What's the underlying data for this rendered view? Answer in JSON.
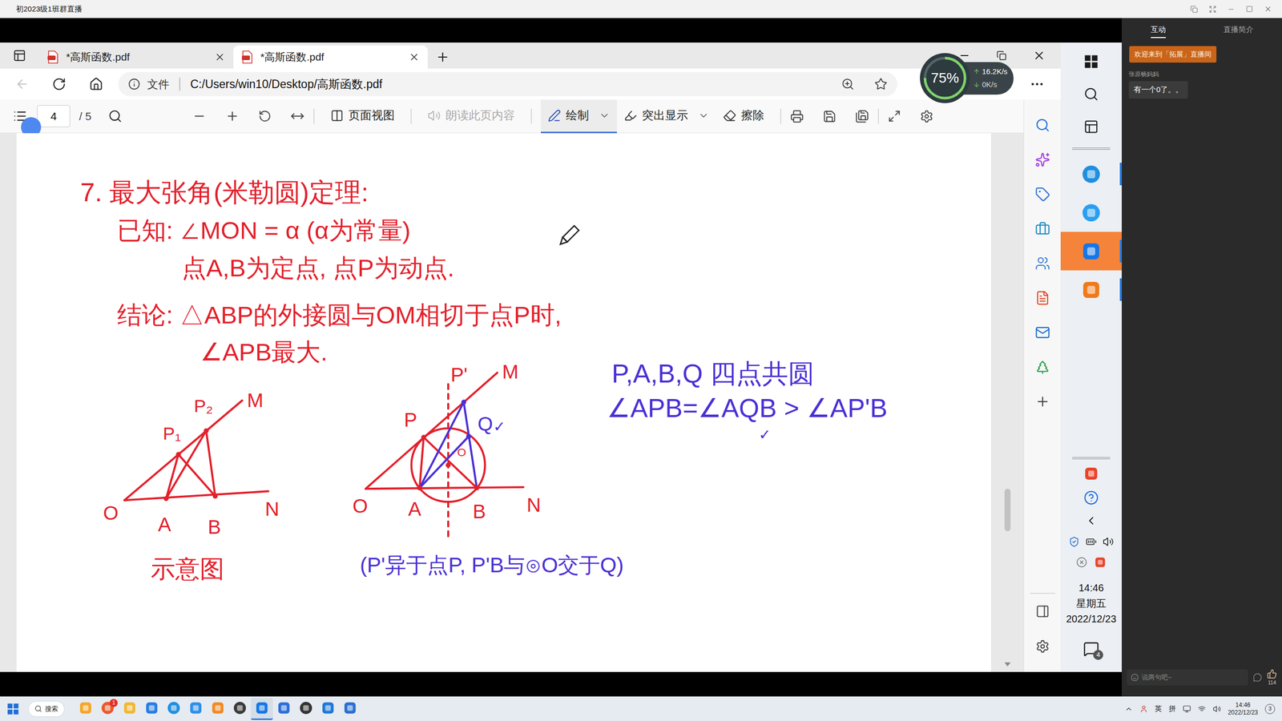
{
  "window": {
    "title": "初2023级1班群直播"
  },
  "browser": {
    "tabs": [
      {
        "label": "*高斯函数.pdf",
        "selected": false
      },
      {
        "label": "*高斯函数.pdf",
        "selected": true
      }
    ],
    "back_disabled": true,
    "address": {
      "scheme": "文件",
      "url": "C:/Users/win10/Desktop/高斯函数.pdf"
    }
  },
  "speed_widget": {
    "percent": "75%",
    "level": 0.75,
    "upload": "16.2K/s",
    "download": "0K/s"
  },
  "pdf_toolbar": {
    "page": "4",
    "total": "/ 5",
    "tools": [
      {
        "label": "页面视图",
        "selected": false,
        "disabled": false,
        "dropdown": false
      },
      {
        "label": "朗读此页内容",
        "selected": false,
        "disabled": true,
        "dropdown": false
      },
      {
        "label": "绘制",
        "selected": true,
        "disabled": false,
        "dropdown": true
      },
      {
        "label": "突出显示",
        "selected": false,
        "disabled": false,
        "dropdown": true
      },
      {
        "label": "擦除",
        "selected": false,
        "disabled": false,
        "dropdown": false
      }
    ]
  },
  "document": {
    "title": "7. 最大张角(米勒圆)定理:",
    "lines": [
      "已知: ∠MON = α (α为常量)",
      "点A,B为定点, 点P为动点.",
      "结论: △ABP的外接圆与OM相切于点P时,",
      "∠APB最大."
    ],
    "figure1": {
      "labels": [
        "O",
        "A",
        "B",
        "N",
        "M",
        "P₁",
        "P₂"
      ],
      "caption": "示意图"
    },
    "figure2": {
      "labels": [
        "O",
        "A",
        "B",
        "N",
        "M",
        "P",
        "P'",
        "Q",
        "O"
      ],
      "check": "✓",
      "caption": "(P'异于点P, P'B与⊙O交于Q)"
    },
    "notes": [
      "P,A,B,Q 四点共圆",
      "∠APB=∠AQB > ∠AP'B"
    ],
    "note_check": "✓"
  },
  "side_taskbar": {
    "apps": [
      {
        "selected": false,
        "running": true
      },
      {
        "selected": false,
        "running": false
      },
      {
        "selected": true,
        "running": true
      },
      {
        "selected": false,
        "running": true
      }
    ],
    "clock": {
      "time": "14:46",
      "weekday": "星期五",
      "date": "2022/12/23"
    },
    "notifications": "4"
  },
  "chat": {
    "tabs": [
      {
        "label": "互动",
        "selected": true
      },
      {
        "label": "直播简介",
        "selected": false
      }
    ],
    "banner": "欢迎来到「拓展」直播间",
    "messages": [
      {
        "user": "张原畅妈妈",
        "text": "有一个0了。。"
      }
    ],
    "input": {
      "placeholder": "说两句吧~"
    },
    "likes": "114"
  },
  "taskbar": {
    "search": "搜索",
    "apps": [
      {
        "selected": false,
        "badge": ""
      },
      {
        "selected": false,
        "badge": "1"
      },
      {
        "selected": false,
        "badge": ""
      },
      {
        "selected": false,
        "badge": ""
      },
      {
        "selected": false,
        "badge": ""
      },
      {
        "selected": false,
        "badge": ""
      },
      {
        "selected": false,
        "badge": ""
      },
      {
        "selected": false,
        "badge": ""
      },
      {
        "selected": true,
        "badge": ""
      },
      {
        "selected": false,
        "badge": ""
      },
      {
        "selected": false,
        "badge": ""
      },
      {
        "selected": false,
        "badge": ""
      },
      {
        "selected": false,
        "badge": ""
      }
    ],
    "tray": {
      "ime": [
        "英",
        "拼"
      ],
      "time": "14:46",
      "date": "2022/12/23",
      "badge": "3"
    }
  }
}
